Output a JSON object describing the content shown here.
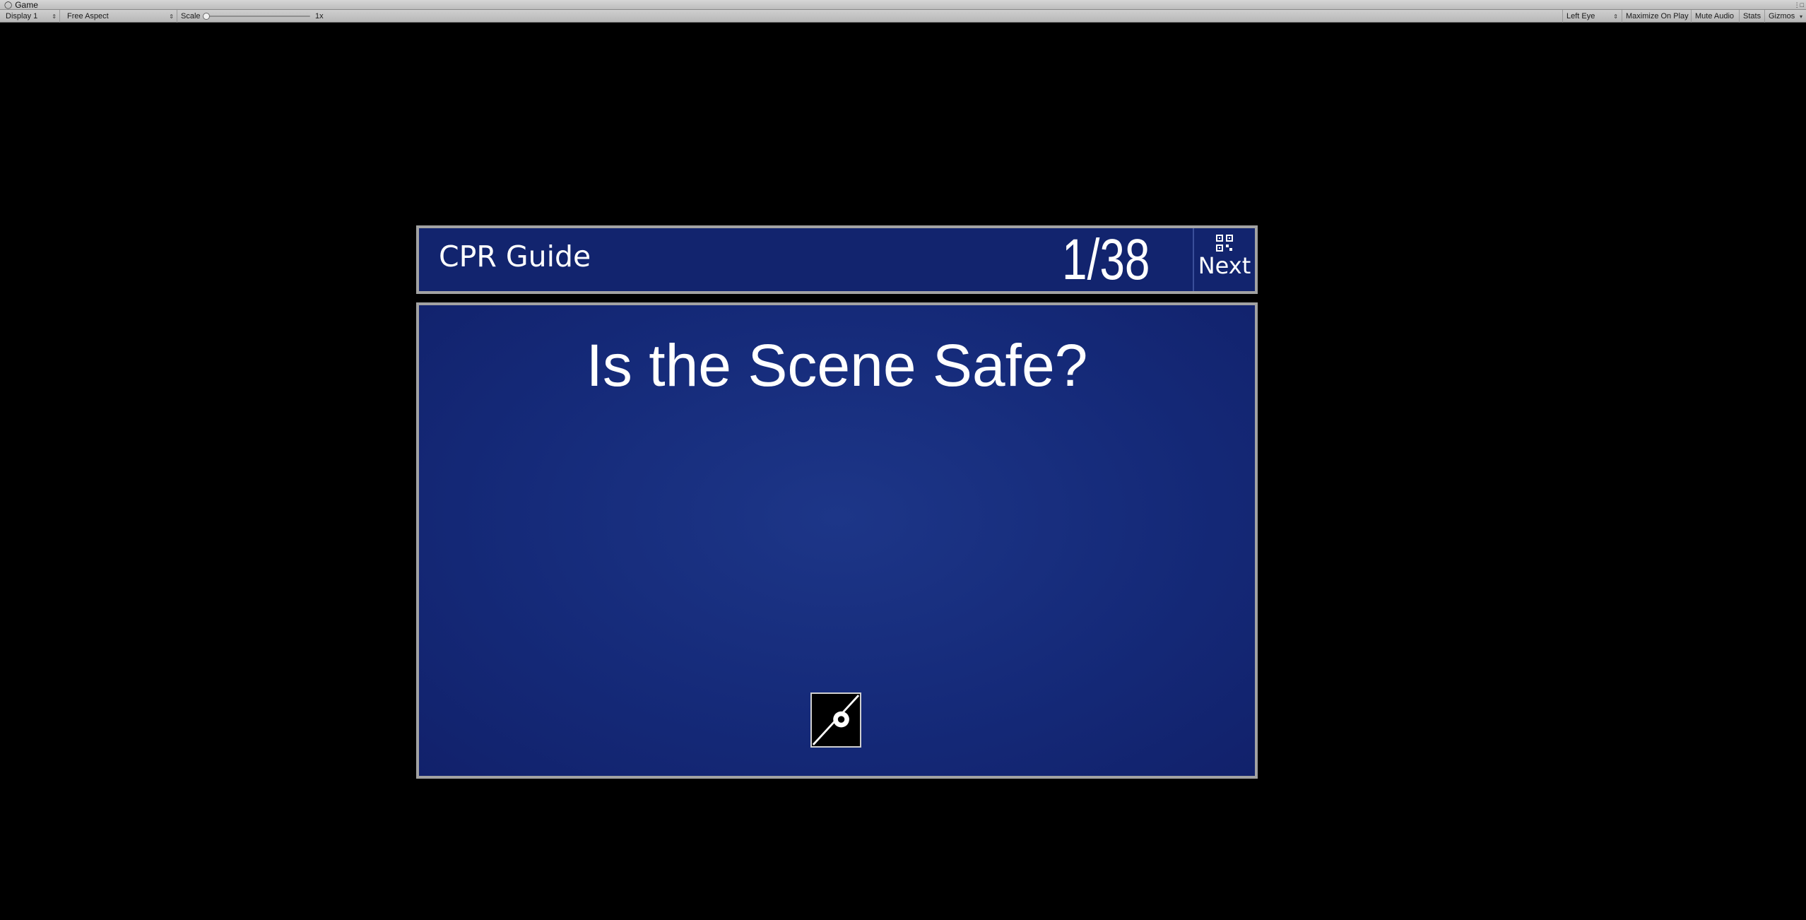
{
  "editor": {
    "tab_title": "Game",
    "toolbar": {
      "display_label": "Display 1",
      "aspect_label": "Free Aspect",
      "scale_label": "Scale",
      "scale_value": "1x",
      "scale_level": 0,
      "eye_label": "Left Eye",
      "maximize_label": "Maximize On Play",
      "mute_label": "Mute Audio",
      "stats_label": "Stats",
      "gizmos_label": "Gizmos"
    }
  },
  "game": {
    "header": {
      "title": "CPR Guide",
      "page_counter": "1/38",
      "next_label": "Next",
      "next_icon": "qr-code-icon"
    },
    "content": {
      "heading": "Is the Scene Safe?",
      "media_icon": "missing-image-icon"
    },
    "colors": {
      "panel_blue": "#12246e",
      "panel_border": "#a2a2a2",
      "background": "#000000"
    }
  }
}
